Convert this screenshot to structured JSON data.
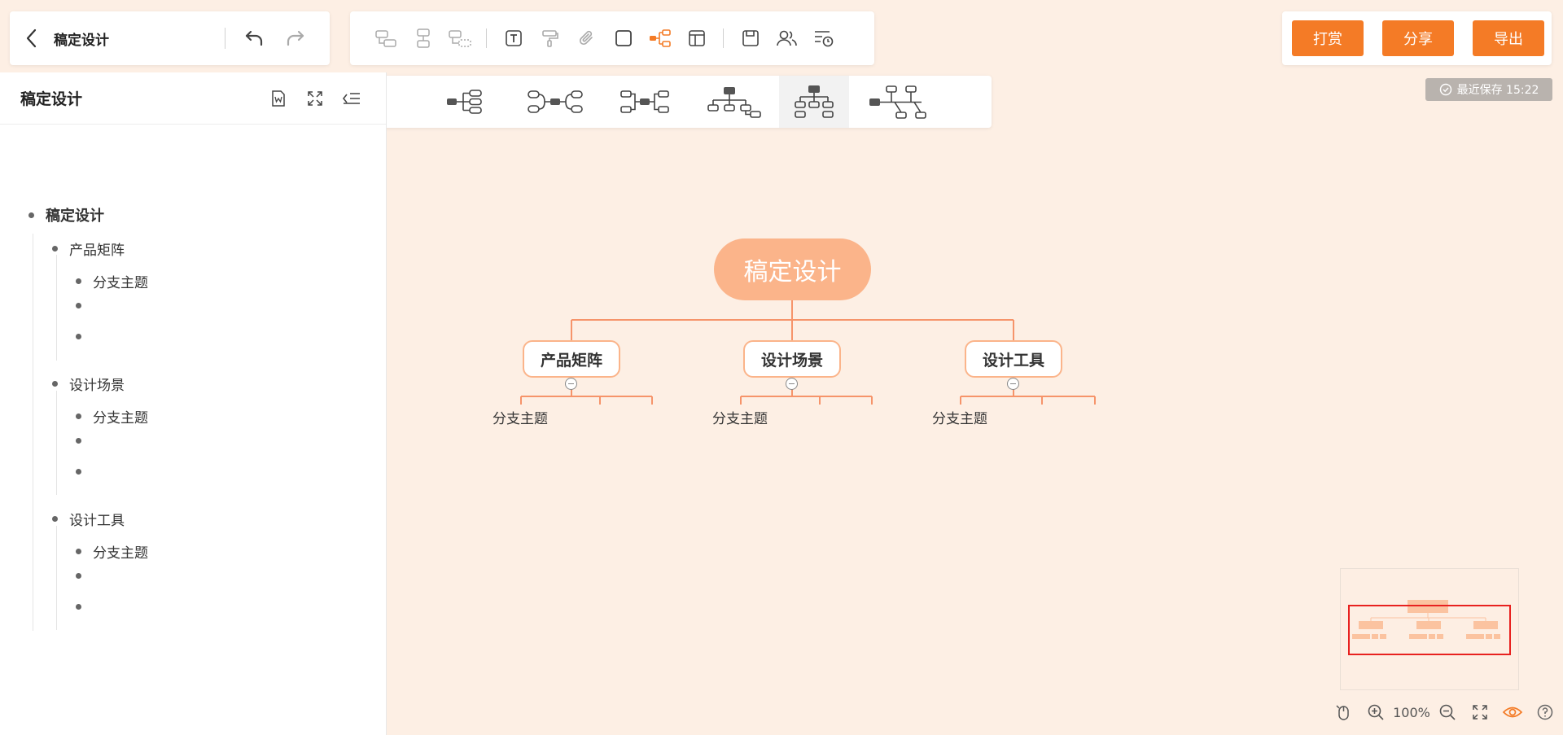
{
  "header": {
    "title": "稿定设计"
  },
  "toolbar": {
    "icons": [
      "sibling-topic-icon",
      "child-topic-icon",
      "parent-topic-icon",
      "text-icon",
      "format-painter-icon",
      "attachment-icon",
      "border-icon",
      "structure-icon",
      "layout-icon",
      "save-icon",
      "collaborate-icon",
      "history-icon"
    ]
  },
  "actions": {
    "reward_label": "打赏",
    "share_label": "分享",
    "export_label": "导出",
    "accent": "#f47b26"
  },
  "save_status": "最近保存 15:22",
  "sidebar": {
    "title": "稿定设计",
    "outline": {
      "root": "稿定设计",
      "branches": [
        {
          "label": "产品矩阵",
          "children": [
            "分支主题",
            "",
            ""
          ]
        },
        {
          "label": "设计场景",
          "children": [
            "分支主题",
            "",
            ""
          ]
        },
        {
          "label": "设计工具",
          "children": [
            "分支主题",
            "",
            ""
          ]
        }
      ]
    }
  },
  "mindmap": {
    "root": "稿定设计",
    "main_topics": [
      "产品矩阵",
      "设计场景",
      "设计工具"
    ],
    "sub_label": "分支主题",
    "colors": {
      "root_fill": "#fbb48a",
      "line": "#f6946a",
      "node_border": "#fbb48a"
    }
  },
  "status": {
    "zoom": "100%"
  }
}
